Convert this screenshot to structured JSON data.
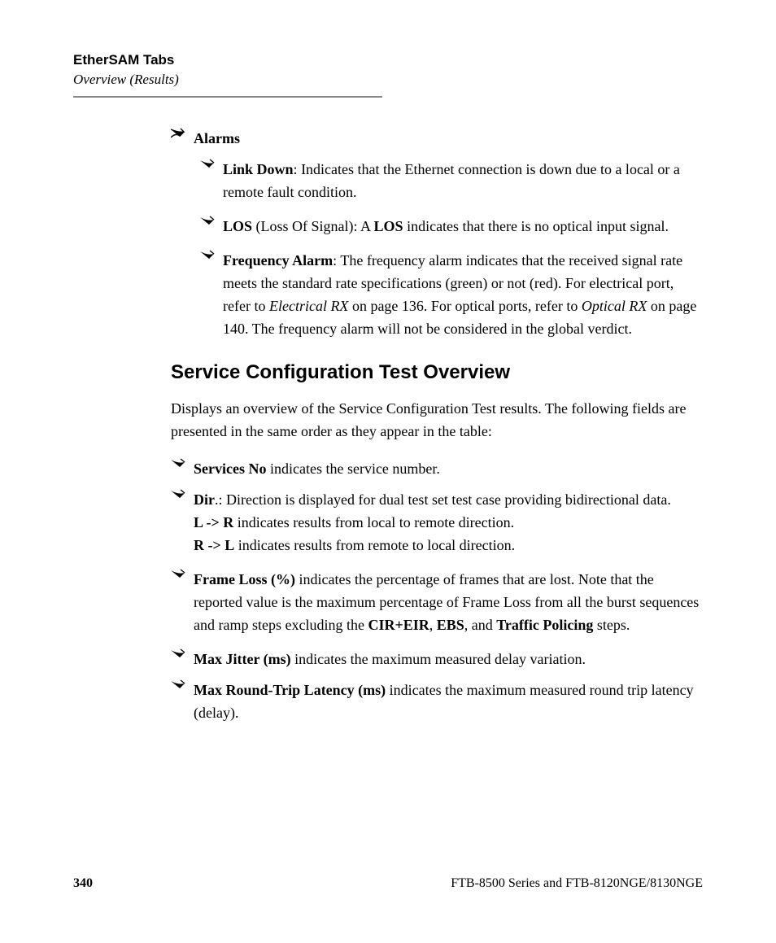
{
  "header": {
    "title": "EtherSAM Tabs",
    "subtitle": "Overview (Results)"
  },
  "alarms": {
    "heading": "Alarms",
    "items": [
      {
        "term": "Link Down",
        "colon": ": ",
        "desc": "Indicates that the Ethernet connection is down due to a local or a remote fault condition."
      },
      {
        "term": "LOS",
        "after_term": " (Loss Of Signal): A ",
        "mid_bold": "LOS",
        "after_mid": " indicates that there is no optical input signal."
      },
      {
        "term": "Frequency Alarm",
        "colon": ": ",
        "pre": "The frequency alarm indicates that the received signal rate meets the standard rate specifications (green) or not (red). For electrical port, refer to ",
        "em1": "Electrical RX",
        "mid1": " on page 136. For optical ports, refer to ",
        "em2": "Optical RX",
        "post": " on page 140. The frequency alarm will not be considered in the global verdict."
      }
    ]
  },
  "section": {
    "heading": "Service Configuration Test Overview",
    "intro": "Displays an overview of the Service Configuration Test results. The following fields are presented in the same order as they appear in the table:",
    "bullets": {
      "services_no": {
        "term": "Services No",
        "text": " indicates the service number."
      },
      "dir": {
        "term": "Dir",
        "after_term": ".: Direction is displayed for dual test set test case providing bidirectional data.",
        "lr_bold": "L -> R",
        "lr_text": " indicates results from local to remote direction.",
        "rl_bold": "R -> L",
        "rl_text": " indicates results from remote to local direction."
      },
      "frame_loss": {
        "term": "Frame Loss (%)",
        "pre": " indicates the percentage of frames that are lost. Note that the reported value is the maximum percentage of Frame Loss from all the burst sequences and ramp steps excluding the ",
        "b1": "CIR+EIR",
        "c1": ", ",
        "b2": "EBS",
        "c2": ", and ",
        "b3": "Traffic Policing",
        "post": " steps."
      },
      "max_jitter": {
        "term": "Max Jitter (ms)",
        "text": " indicates the maximum measured delay variation."
      },
      "max_rtt": {
        "term": "Max Round-Trip Latency (ms)",
        "text": " indicates the maximum measured round trip latency (delay)."
      }
    }
  },
  "footer": {
    "page_number": "340",
    "product": "FTB-8500 Series and FTB-8120NGE/8130NGE"
  }
}
